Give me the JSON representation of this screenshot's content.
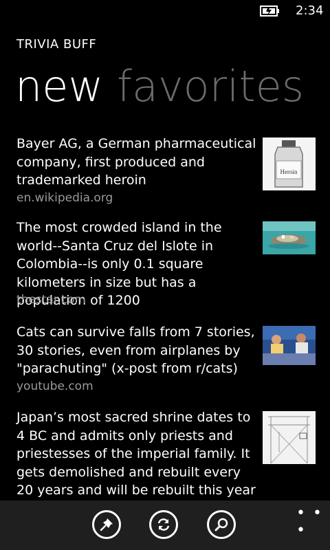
{
  "status": {
    "time": "2:34"
  },
  "app": {
    "title": "TRIVIA BUFF"
  },
  "pivot": {
    "tabs": [
      "new",
      "favorites"
    ],
    "selected": "new"
  },
  "items": [
    {
      "text": "Bayer AG, a German pharmaceutical company, first produced and trademarked heroin",
      "source": "en.wikipedia.org",
      "thumb_label": "Heroin"
    },
    {
      "text": "The most crowded island in the world--Santa Cruz del Islote in Colombia--is only 0.1 square kilometers in size but has a population of 1200",
      "source": "thestar.com"
    },
    {
      "text": "Cats can survive falls from 7 stories, 30 stories, even from airplanes by \"parachuting\" (x-post from r/cats)",
      "source": "youtube.com"
    },
    {
      "text": "Japan’s most sacred shrine dates to 4 BC and admits only priests and priestesses of the imperial family. It gets demolished and rebuilt every 20 years and will be rebuilt this year",
      "source": ""
    }
  ],
  "appbar": {
    "buttons": [
      {
        "icon": "pin-icon"
      },
      {
        "icon": "refresh-icon"
      },
      {
        "icon": "search-icon"
      }
    ],
    "more": "• • •"
  },
  "colors": {
    "background": "#000000",
    "appbar": "#1f1f1f",
    "secondary_text": "#9a9a9a",
    "inactive_pivot": "#6b6b6b"
  }
}
